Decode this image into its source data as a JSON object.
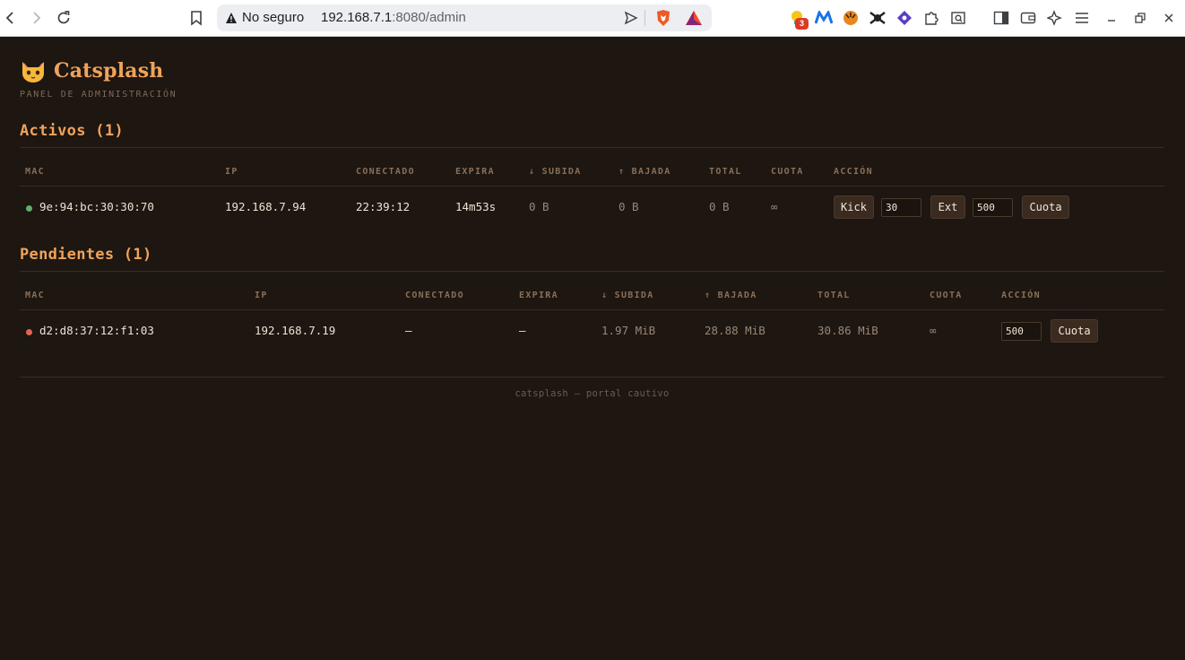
{
  "browser": {
    "security_label": "No seguro",
    "url_host": "192.168.7.1",
    "url_rest": ":8080/admin",
    "extension_badge": "3"
  },
  "header": {
    "title": "Catsplash",
    "subtitle": "PANEL DE ADMINISTRACIÓN"
  },
  "columns": {
    "mac": "MAC",
    "ip": "IP",
    "connected": "CONECTADO",
    "expires": "EXPIRA",
    "upload": "↓ SUBIDA",
    "download": "↑ BAJADA",
    "total": "TOTAL",
    "quota": "CUOTA",
    "action": "ACCIÓN"
  },
  "active": {
    "title": "Activos (1)",
    "rows": [
      {
        "mac": "9e:94:bc:30:30:70",
        "ip": "192.168.7.94",
        "connected": "22:39:12",
        "expires": "14m53s",
        "upload": "0 B",
        "download": "0 B",
        "total": "0 B",
        "quota": "∞",
        "kick_label": "Kick",
        "ext_value": "30",
        "ext_label": "Ext",
        "quota_value": "500",
        "quota_label": "Cuota"
      }
    ]
  },
  "pending": {
    "title": "Pendientes (1)",
    "rows": [
      {
        "mac": "d2:d8:37:12:f1:03",
        "ip": "192.168.7.19",
        "connected": "—",
        "expires": "—",
        "upload": "1.97 MiB",
        "download": "28.88 MiB",
        "total": "30.86 MiB",
        "quota": "∞",
        "quota_value": "500",
        "quota_label": "Cuota"
      }
    ]
  },
  "footer": {
    "text": "catsplash — portal cautivo"
  },
  "colors": {
    "background": "#1d1611",
    "accent": "#f0a35a",
    "status_active": "#5fae6b",
    "status_pending": "#e0674f"
  }
}
